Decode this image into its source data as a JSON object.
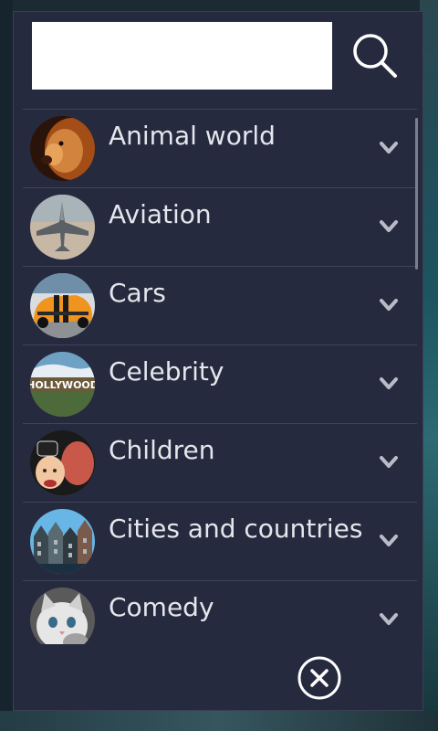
{
  "search": {
    "value": "",
    "placeholder": ""
  },
  "categories": [
    {
      "label": "Animal world",
      "image": "lion",
      "colors": [
        "#c4621e",
        "#e8a35a",
        "#3a1a0c"
      ]
    },
    {
      "label": "Aviation",
      "image": "fighter-jet",
      "colors": [
        "#9aa3a8",
        "#5b6066",
        "#c7b8a6"
      ]
    },
    {
      "label": "Cars",
      "image": "orange-sports-car",
      "colors": [
        "#f09420",
        "#1a1a1a",
        "#6f8fa8"
      ]
    },
    {
      "label": "Celebrity",
      "image": "hollywood-sign",
      "colors": [
        "#6fa1c4",
        "#ffffff",
        "#6a5a3a"
      ]
    },
    {
      "label": "Children",
      "image": "father-and-child",
      "colors": [
        "#c7584a",
        "#222222",
        "#f0c7a0"
      ]
    },
    {
      "label": "Cities and countries",
      "image": "city-houses",
      "colors": [
        "#68b6e6",
        "#3a4850",
        "#b0b6b8"
      ]
    },
    {
      "label": "Comedy",
      "image": "kitten",
      "colors": [
        "#e6e6e6",
        "#a0a0a0",
        "#5a5a5a"
      ]
    }
  ],
  "icons": {
    "search": "search-icon",
    "close": "close-icon",
    "expand": "chevron-down-icon"
  },
  "theme": {
    "panel": "#262a3e",
    "text": "#e4e6ec",
    "divider": "#3f4459",
    "icon": "#b9bcc6"
  }
}
